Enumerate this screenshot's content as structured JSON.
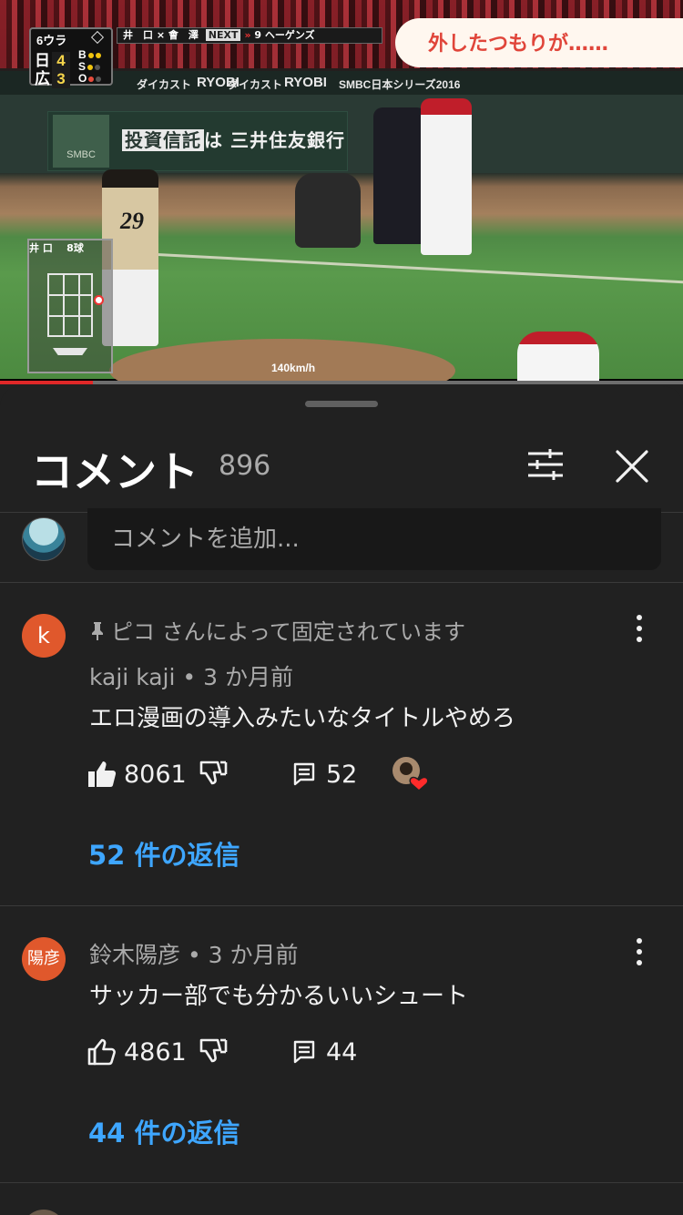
{
  "video": {
    "caption": "外したつもりが……",
    "scorebug": {
      "inning": "6ウラ",
      "team1": "日",
      "team1_score": "4",
      "team2": "広",
      "team2_score": "3",
      "bso": "B\nS\nO"
    },
    "matchup": {
      "pitcher": "井　口",
      "vs": "×",
      "batter": "會　澤",
      "next_label": "NEXT",
      "next_player": "9 ヘーゲンズ"
    },
    "sponsors": [
      "ダイカスト",
      "RYOBI",
      "ダイカスト",
      "RYOBI",
      "SMBC日本シリーズ2016"
    ],
    "ad_logo": "SMBC",
    "ad_box": "投資信託",
    "ad_rest": "は 三井住友銀行",
    "jersey_number": "29",
    "pitch_info": {
      "pitcher": "井 口",
      "count": "8球",
      "pitch_no": "②"
    },
    "speed": "140km/h",
    "progress_percent": 13.6,
    "accent_color": "#e02828"
  },
  "comments_panel": {
    "title": "コメント",
    "count": "896",
    "filter_icon": "filter-sliders-icon",
    "close_icon": "close-icon",
    "add_comment_placeholder": "コメントを追加...",
    "comments": [
      {
        "avatar_text": "k",
        "avatar_color": "#e0582c",
        "pinned_text": "ピコ さんによって固定されています",
        "author": "kaji kaji",
        "time": "3 か月前",
        "text": "エロ漫画の導入みたいなタイトルやめろ",
        "likes": "8061",
        "reply_count": "52",
        "liked_by_creator": true,
        "replies_label": "52 件の返信"
      },
      {
        "avatar_text": "陽彦",
        "avatar_color": "#e0582c",
        "author": "鈴木陽彦",
        "time": "3 か月前",
        "text": "サッカー部でも分かるいいシュート",
        "likes": "4861",
        "reply_count": "44",
        "liked_by_creator": false,
        "replies_label": "44 件の返信"
      }
    ],
    "link_color": "#3ea6ff"
  }
}
